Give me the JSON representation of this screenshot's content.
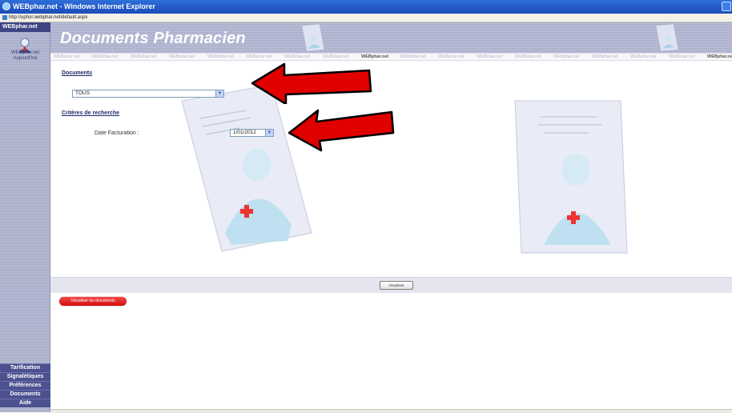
{
  "window": {
    "title": "WEBphar.net - Windows Internet Explorer",
    "url": "http://uphor.webphar.net/default.aspx"
  },
  "sidebar": {
    "brand": "WEBphar.net",
    "today_line1": "WEBphar.net",
    "today_line2": "Aujourd'hui",
    "nav": [
      {
        "label": "Tarification"
      },
      {
        "label": "Signalétiques"
      },
      {
        "label": "Préférences"
      },
      {
        "label": "Documents"
      },
      {
        "label": "Aide"
      }
    ]
  },
  "header": {
    "title": "Documents Pharmacien",
    "strip_word": "WEBphar.net"
  },
  "form": {
    "documents_label": "Documents",
    "documents_value": "TOUS",
    "criteria_label": "Critères de recherche",
    "date_label": "Date Facturation :",
    "date_value": "1/01/2012"
  },
  "actions": {
    "visualiser_label": "Visualiser",
    "red_button_label": "Visualiser les documents"
  },
  "colors": {
    "sidebar_nav": "#4b518f",
    "header_band": "#b4b8d2",
    "arrow": "#e00000",
    "red_button": "#e01b1b"
  },
  "icons": {
    "window": "ie-icon",
    "avatar": "pharmacist-icon",
    "document": "document-pharmacist-icon",
    "dropdown": "chevron-down-icon"
  }
}
